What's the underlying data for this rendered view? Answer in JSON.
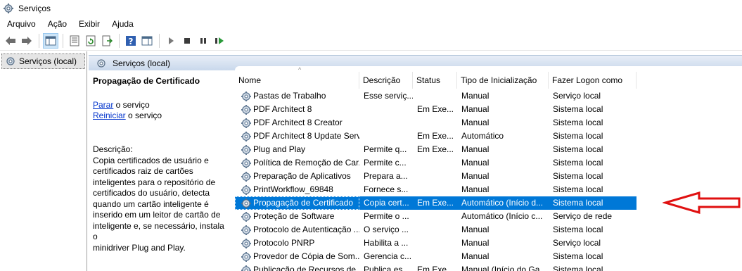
{
  "window": {
    "title": "Serviços"
  },
  "menu": [
    "Arquivo",
    "Ação",
    "Exibir",
    "Ajuda"
  ],
  "tree": {
    "root_label": "Serviços (local)"
  },
  "panel": {
    "header_label": "Serviços (local)"
  },
  "detail": {
    "title": "Propagação de Certificado",
    "stop_link": "Parar",
    "stop_rest": " o serviço",
    "restart_link": "Reiniciar",
    "restart_rest": " o serviço",
    "description_label": "Descrição:",
    "description_lines": [
      "Copia certificados de usuário e",
      "certificados raiz de cartões",
      "inteligentes para o repositório de",
      "certificados do usuário, detecta",
      "quando um cartão inteligente é",
      "inserido em um leitor de cartão de",
      "inteligente e, se necessário, instala o",
      "minidriver Plug and Play."
    ]
  },
  "columns": {
    "name": "Nome",
    "description": "Descrição",
    "status": "Status",
    "startup": "Tipo de Inicialização",
    "logon": "Fazer Logon como"
  },
  "services": [
    {
      "name": "Pastas de Trabalho",
      "description": "Esse serviç...",
      "status": "",
      "startup": "Manual",
      "logon": "Serviço local",
      "selected": false
    },
    {
      "name": "PDF Architect 8",
      "description": "",
      "status": "Em Exe...",
      "startup": "Manual",
      "logon": "Sistema local",
      "selected": false
    },
    {
      "name": "PDF Architect 8 Creator",
      "description": "",
      "status": "",
      "startup": "Manual",
      "logon": "Sistema local",
      "selected": false
    },
    {
      "name": "PDF Architect 8 Update Serv...",
      "description": "",
      "status": "Em Exe...",
      "startup": "Automático",
      "logon": "Sistema local",
      "selected": false
    },
    {
      "name": "Plug and Play",
      "description": "Permite q...",
      "status": "Em Exe...",
      "startup": "Manual",
      "logon": "Sistema local",
      "selected": false
    },
    {
      "name": "Política de Remoção de Car...",
      "description": "Permite c...",
      "status": "",
      "startup": "Manual",
      "logon": "Sistema local",
      "selected": false
    },
    {
      "name": "Preparação de Aplicativos",
      "description": "Prepara a...",
      "status": "",
      "startup": "Manual",
      "logon": "Sistema local",
      "selected": false
    },
    {
      "name": "PrintWorkflow_69848",
      "description": "Fornece s...",
      "status": "",
      "startup": "Manual",
      "logon": "Sistema local",
      "selected": false
    },
    {
      "name": "Propagação de Certificado",
      "description": "Copia cert...",
      "status": "Em Exe...",
      "startup": "Automático (Início d...",
      "logon": "Sistema local",
      "selected": true
    },
    {
      "name": "Proteção de Software",
      "description": "Permite o ...",
      "status": "",
      "startup": "Automático (Início c...",
      "logon": "Serviço de rede",
      "selected": false
    },
    {
      "name": "Protocolo de Autenticação ...",
      "description": "O serviço ...",
      "status": "",
      "startup": "Manual",
      "logon": "Sistema local",
      "selected": false
    },
    {
      "name": "Protocolo PNRP",
      "description": "Habilita a ...",
      "status": "",
      "startup": "Manual",
      "logon": "Serviço local",
      "selected": false
    },
    {
      "name": "Provedor de Cópia de Som...",
      "description": "Gerencia c...",
      "status": "",
      "startup": "Manual",
      "logon": "Sistema local",
      "selected": false
    },
    {
      "name": "Publicação de Recursos de ...",
      "description": "Publica es...",
      "status": "Em Exe...",
      "startup": "Manual (Início do Ga...",
      "logon": "Sistema local",
      "selected": false
    }
  ],
  "colors": {
    "selection": "#0078d7",
    "link": "#0033cc",
    "annotation_arrow": "#e01010"
  },
  "icons": [
    "services-gear-icon",
    "back-arrow-icon",
    "forward-arrow-icon",
    "console-tree-icon",
    "properties-icon",
    "refresh-icon",
    "export-list-icon",
    "help-icon",
    "show-hide-icon",
    "play-icon",
    "stop-icon",
    "pause-icon",
    "restart-icon"
  ]
}
